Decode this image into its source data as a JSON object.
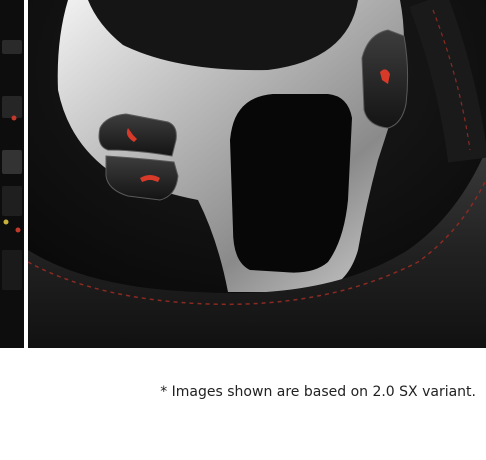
{
  "caption": {
    "text": "* Images shown are based on 2.0 SX variant."
  },
  "photo": {
    "subject": "steering-wheel",
    "accent_color": "#d83a2a",
    "icons": [
      "phone-answer-icon",
      "phone-hangup-icon",
      "voice-command-icon"
    ]
  }
}
